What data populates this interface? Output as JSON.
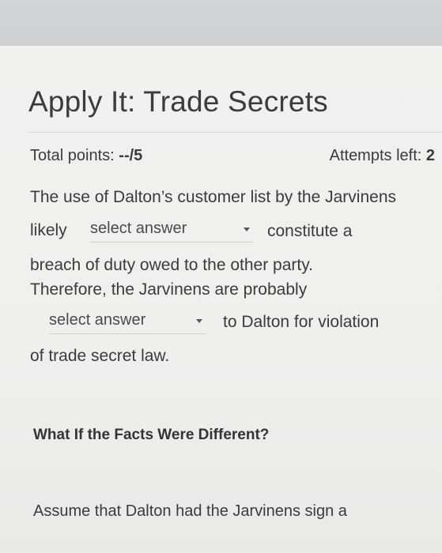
{
  "title": "Apply It: Trade Secrets",
  "score": {
    "points_label": "Total points: ",
    "points_value": "--/5",
    "attempts_label": "Attempts left: ",
    "attempts_value": "2"
  },
  "question": {
    "line1": "The use of Dalton’s customer list by the Jarvinens",
    "line2_prefix": "likely",
    "dropdown1": "select answer",
    "line2_suffix": "constitute a",
    "line3": "breach of duty owed to the other party.",
    "line4": "Therefore, the Jarvinens are probably",
    "dropdown2": "select answer",
    "line5_suffix": "to Dalton for violation",
    "line6": "of trade secret law."
  },
  "what_if": {
    "heading": "What If the Facts Were Different?",
    "text": "Assume that Dalton had the Jarvinens sign a"
  }
}
